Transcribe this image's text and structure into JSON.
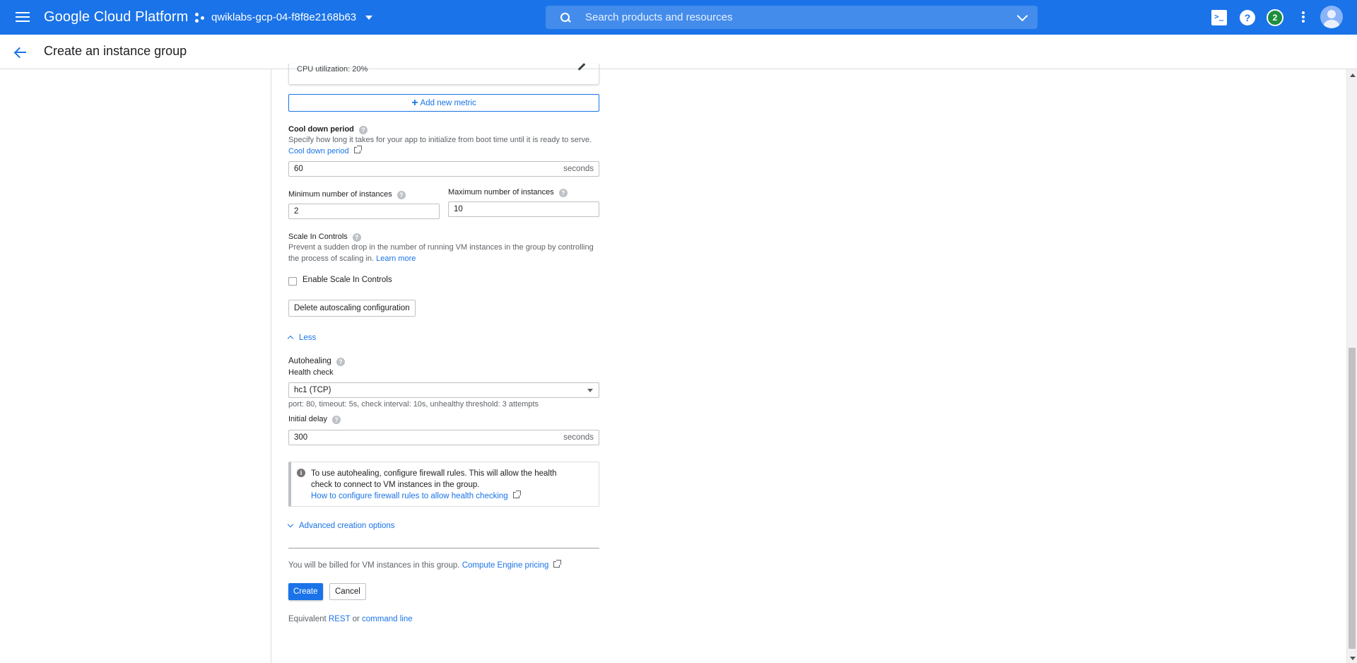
{
  "topbar": {
    "brand": "Google Cloud Platform",
    "project": "qwiklabs-gcp-04-f8f8e2168b63",
    "search_placeholder": "Search products and resources",
    "notification_count": "2"
  },
  "header": {
    "title": "Create an instance group"
  },
  "autoscaling": {
    "metric_label": "CPU utilization: 20%",
    "add_metric": "Add new metric",
    "cooldown": {
      "label": "Cool down period",
      "description": "Specify how long it takes for your app to initialize from boot time until it is ready to serve.",
      "link": "Cool down period",
      "value": "60",
      "unit": "seconds"
    },
    "min_instances": {
      "label": "Minimum number of instances",
      "value": "2"
    },
    "max_instances": {
      "label": "Maximum number of instances",
      "value": "10"
    },
    "scale_in": {
      "label": "Scale In Controls",
      "description": "Prevent a sudden drop in the number of running VM instances in the group by controlling the process of scaling in.",
      "learn_more": "Learn more",
      "checkbox_label": "Enable Scale In Controls"
    },
    "delete_button": "Delete autoscaling configuration"
  },
  "less_toggle": "Less",
  "autohealing": {
    "title": "Autohealing",
    "health_check_label": "Health check",
    "health_check_value": "hc1 (TCP)",
    "health_check_details": "port: 80, timeout: 5s, check interval: 10s, unhealthy threshold: 3 attempts",
    "initial_delay_label": "Initial delay",
    "initial_delay_value": "300",
    "initial_delay_unit": "seconds",
    "info_text": "To use autohealing, configure firewall rules. This will allow the health check to connect to VM instances in the group.",
    "info_link": "How to configure firewall rules to allow health checking"
  },
  "advanced_toggle": "Advanced creation options",
  "billing": {
    "text": "You will be billed for VM instances in this group.",
    "link": "Compute Engine pricing"
  },
  "actions": {
    "create": "Create",
    "cancel": "Cancel"
  },
  "equivalent": {
    "prefix": "Equivalent",
    "rest": "REST",
    "or": "or",
    "command_line": "command line"
  }
}
